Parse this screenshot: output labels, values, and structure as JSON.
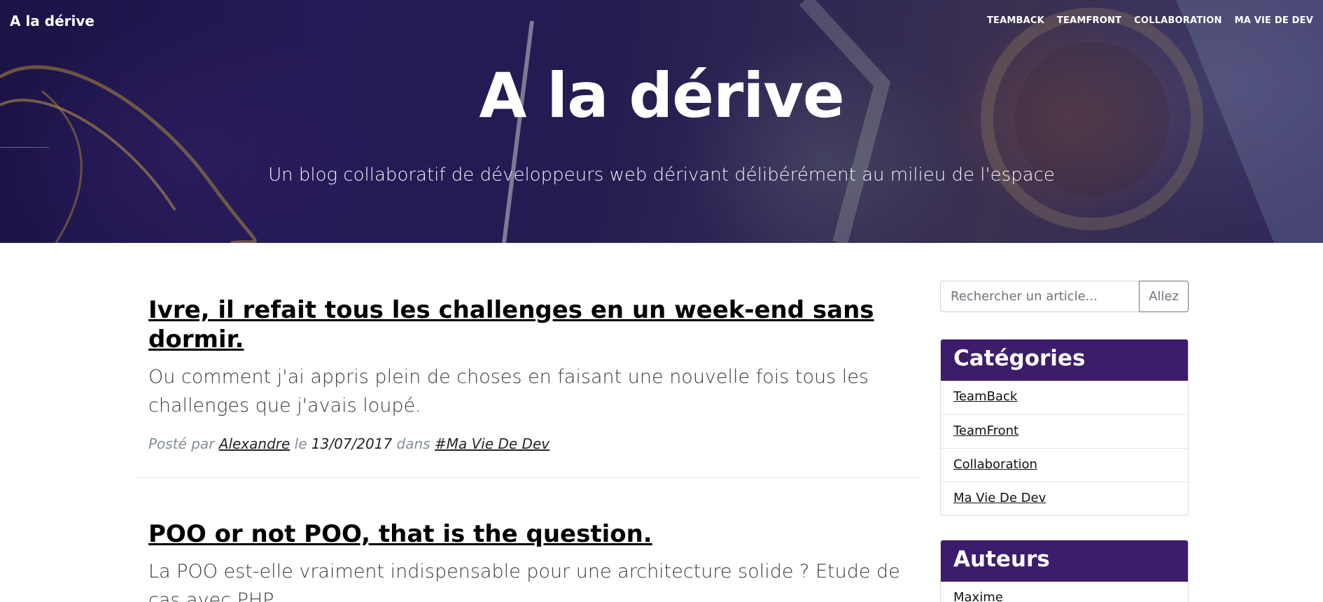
{
  "navbar": {
    "brand": "A la dérive",
    "links": [
      "TEAMBACK",
      "TEAMFRONT",
      "COLLABORATION",
      "MA VIE DE DEV"
    ]
  },
  "hero": {
    "title": "A la dérive",
    "subtitle": "Un blog collaboratif de développeurs web dérivant délibérément au milieu de l'espace"
  },
  "posts": [
    {
      "title": "Ivre, il refait tous les challenges en un week-end sans dormir.",
      "subtitle": "Ou comment j'ai appris plein de choses en faisant une nouvelle fois tous les challenges que j'avais loupé.",
      "meta_posted_by": "Posté par",
      "author": "Alexandre",
      "meta_on": "le",
      "date": "13/07/2017",
      "meta_in": "dans",
      "category": "#Ma Vie De Dev"
    },
    {
      "title": "POO or not POO, that is the question.",
      "subtitle": "La POO est-elle vraiment indispensable pour une architecture solide ? Etude de cas avec PHP"
    }
  ],
  "sidebar": {
    "search": {
      "placeholder": "Rechercher un article...",
      "button_label": "Allez"
    },
    "categories": {
      "title": "Catégories",
      "items": [
        "TeamBack",
        "TeamFront",
        "Collaboration",
        "Ma Vie De Dev"
      ]
    },
    "authors": {
      "title": "Auteurs",
      "items": [
        "Maxime"
      ]
    }
  },
  "colors": {
    "card_header": "#3d1d6b",
    "hero_tint": "#1e1050",
    "meta_gray": "#868e96"
  }
}
